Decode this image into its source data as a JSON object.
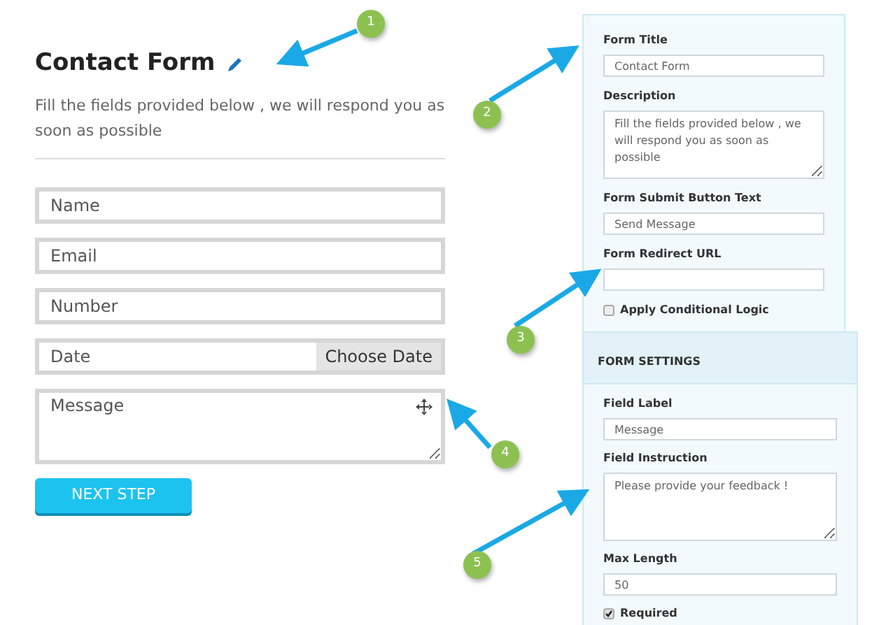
{
  "form": {
    "title": "Contact Form",
    "description": "Fill the fields provided below , we will respond you as soon as possible",
    "fields": [
      {
        "kind": "input",
        "placeholder": "Name"
      },
      {
        "kind": "input",
        "placeholder": "Email"
      },
      {
        "kind": "input",
        "placeholder": "Number"
      },
      {
        "kind": "date",
        "placeholder": "Date",
        "button": "Choose Date"
      },
      {
        "kind": "textarea",
        "placeholder": "Message"
      }
    ],
    "submit": "NEXT STEP"
  },
  "form_panel": {
    "fields": [
      {
        "kind": "input",
        "label": "Form Title",
        "value": "Contact Form"
      },
      {
        "kind": "textarea",
        "label": "Description",
        "value": "Fill the fields provided below , we will respond you as soon as possible"
      },
      {
        "kind": "input",
        "label": "Form Submit Button Text",
        "value": "Send Message"
      },
      {
        "kind": "input",
        "label": "Form Redirect URL"
      }
    ],
    "checkbox": {
      "label": "Apply Conditional Logic",
      "checked": false
    }
  },
  "settings_panel": {
    "header": "FORM SETTINGS",
    "fields": [
      {
        "kind": "input",
        "label": "Field Label",
        "value": "Message"
      },
      {
        "kind": "textarea",
        "label": "Field Instruction",
        "value": "Please provide your feedback !"
      },
      {
        "kind": "input",
        "label": "Max Length",
        "value": "50"
      }
    ],
    "checkbox": {
      "label": "Required",
      "checked": true
    }
  },
  "callouts": [
    "1",
    "2",
    "3",
    "4",
    "5"
  ]
}
